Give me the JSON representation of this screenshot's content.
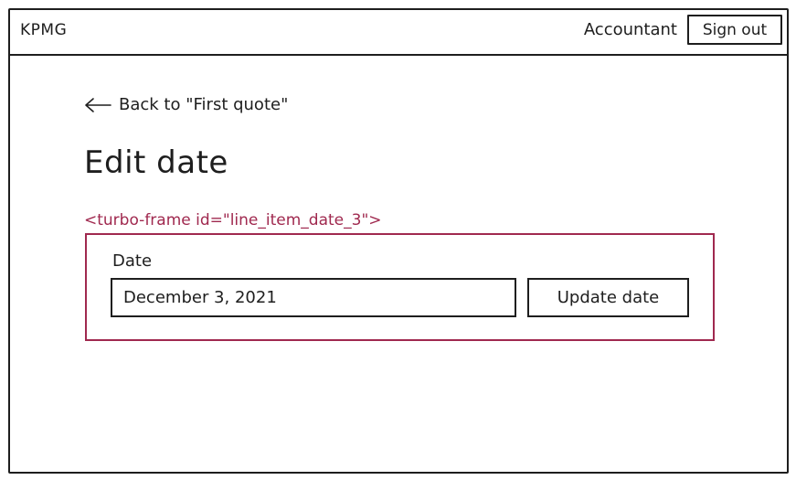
{
  "header": {
    "brand": "KPMG",
    "user_name": "Accountant",
    "sign_out_label": "Sign out"
  },
  "main": {
    "back_link_text": "Back to \"First quote\"",
    "back_icon": "arrow-left-icon",
    "title": "Edit date",
    "turbo_frame_tag": "<turbo-frame id=\"line_item_date_3\">",
    "form": {
      "date_label": "Date",
      "date_value": "December 3, 2021",
      "submit_label": "Update date"
    }
  },
  "colors": {
    "ink": "#1e1e1e",
    "turbo_frame_accent": "#a0294f",
    "background": "#ffffff"
  }
}
